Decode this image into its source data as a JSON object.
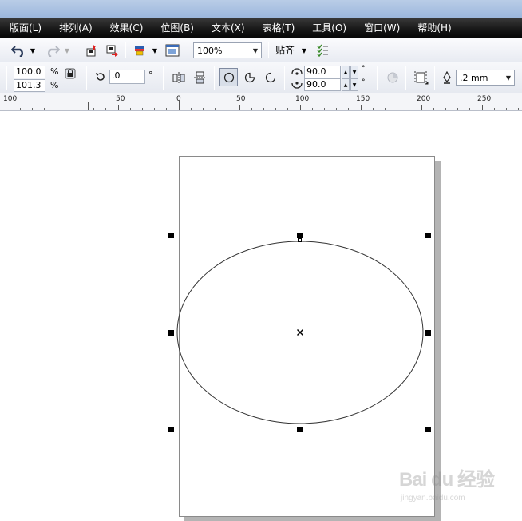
{
  "menu": [
    {
      "label": "版面(L)",
      "name": "menu-layout"
    },
    {
      "label": "排列(A)",
      "name": "menu-arrange"
    },
    {
      "label": "效果(C)",
      "name": "menu-effects"
    },
    {
      "label": "位图(B)",
      "name": "menu-bitmaps"
    },
    {
      "label": "文本(X)",
      "name": "menu-text"
    },
    {
      "label": "表格(T)",
      "name": "menu-table"
    },
    {
      "label": "工具(O)",
      "name": "menu-tools"
    },
    {
      "label": "窗口(W)",
      "name": "menu-window"
    },
    {
      "label": "帮助(H)",
      "name": "menu-help"
    }
  ],
  "toolbar": {
    "zoom": "100%",
    "snap_label": "贴齐"
  },
  "property_bar": {
    "scale_x": "100.0",
    "scale_y": "101.3",
    "percent": "%",
    "rotation": ".0",
    "degree": "°",
    "start_angle": "90.0",
    "end_angle": "90.0",
    "outline_width": ".2 mm"
  },
  "ruler": {
    "labels": [
      "100",
      "50",
      "0",
      "50",
      "100",
      "150",
      "200",
      "250"
    ]
  },
  "watermark": {
    "main": "Bai du 经验",
    "sub": "jingyan.baidu.com"
  }
}
